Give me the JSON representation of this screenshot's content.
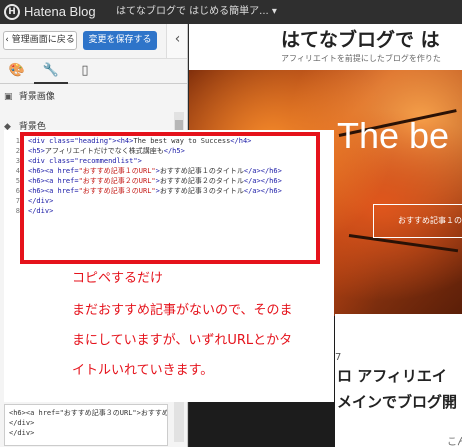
{
  "topbar": {
    "brand": "Hatena Blog",
    "blog_title": "はてなブログで はじめる簡単ア... ▾"
  },
  "left": {
    "back_label": "管理画面に戻る",
    "save_label": "変更を保存する",
    "collapse_glyph": "‹",
    "tabs": [
      {
        "name": "palette",
        "glyph": "🎨"
      },
      {
        "name": "wrench",
        "glyph": "🔧"
      },
      {
        "name": "mobile",
        "glyph": "▯"
      }
    ],
    "sections": [
      {
        "label": "背景画像",
        "glyph": "▣"
      },
      {
        "label": "背景色",
        "glyph": "◆"
      }
    ],
    "bottom_code": [
      "<h6><a href=\"おすすめ記事３のURL\">おすすめ",
      "</div>",
      "</div>"
    ]
  },
  "editor": {
    "lines": [
      {
        "n": "1",
        "html": "<span class='tag'>&lt;div class=\"heading\"&gt;&lt;h4&gt;</span>The best way to Success<span class='tag'>&lt;/h4&gt;</span>"
      },
      {
        "n": "2",
        "html": "<span class='tag'>&lt;h5&gt;</span>アフィリエイトだけでなく株式講座も<span class='tag'>&lt;/h5&gt;</span>"
      },
      {
        "n": "3",
        "html": "<span class='tag'>&lt;div class=\"recommendlist\"&gt;</span>"
      },
      {
        "n": "4",
        "html": "<span class='tag'>&lt;h6&gt;&lt;a href=</span><span class='str'>\"おすすめ記事１のURL\"</span><span class='tag'>&gt;</span>おすすめ記事１のタイトル<span class='tag'>&lt;/a&gt;&lt;/h6&gt;</span>"
      },
      {
        "n": "5",
        "html": "<span class='tag'>&lt;h6&gt;&lt;a href=</span><span class='str'>\"おすすめ記事２のURL\"</span><span class='tag'>&gt;</span>おすすめ記事２のタイトル<span class='tag'>&lt;/a&gt;&lt;/h6&gt;</span>"
      },
      {
        "n": "6",
        "html": "<span class='tag'>&lt;h6&gt;&lt;a href=</span><span class='str'>\"おすすめ記事３のURL\"</span><span class='tag'>&gt;</span>おすすめ記事３のタイトル<span class='tag'>&lt;/a&gt;&lt;/h6&gt;</span>"
      },
      {
        "n": "7",
        "html": "<span class='tag'>&lt;/div&gt;</span>"
      },
      {
        "n": "8",
        "html": "<span class='tag'>&lt;/div&gt;</span>"
      }
    ]
  },
  "annotation": {
    "lines": [
      "コピペするだけ",
      "まだおすすめ記事がないので、そのま",
      "まにしていますが、いずれURLとかタ",
      "イトルいれていきます。"
    ]
  },
  "preview": {
    "title": "はてなブログで は",
    "subtitle": "アフィリエイトを前提にしたブログを作りた",
    "hero_text": "The be",
    "hero_button": "おすすめ記事１の",
    "date_fragment": "7",
    "post_title_1": "ロ アフィリエイ",
    "post_title_2": "メインでブログ開",
    "intro": "こんにちは、mymykenshinです。前回"
  },
  "colors": {
    "annotation_red": "#e5121b",
    "save_button_blue": "#2e74c9"
  }
}
